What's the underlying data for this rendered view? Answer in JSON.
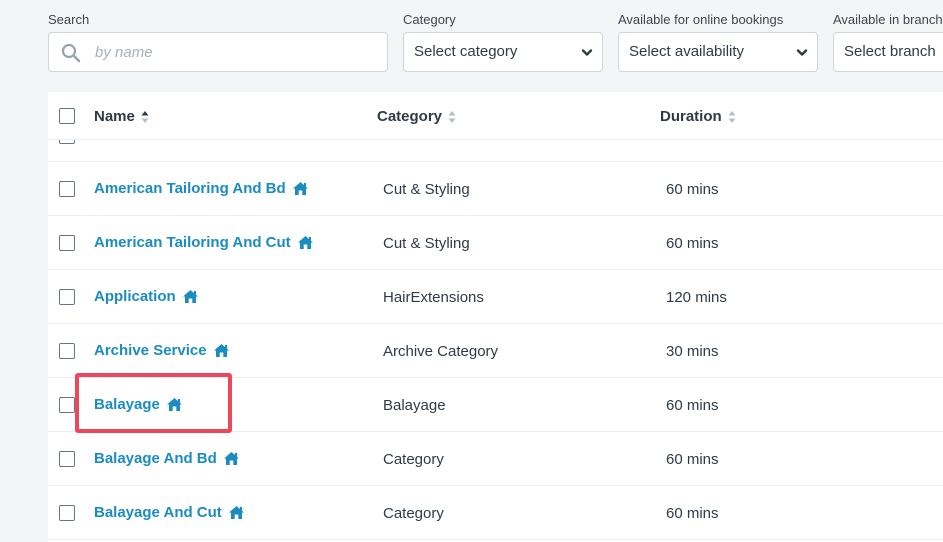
{
  "filters": {
    "search": {
      "label": "Search",
      "placeholder": "by name",
      "value": ""
    },
    "category": {
      "label": "Category",
      "selected": "Select category"
    },
    "online_bookings": {
      "label": "Available for online bookings",
      "selected": "Select availability"
    },
    "branch": {
      "label": "Available in branch",
      "selected": "Select branch"
    }
  },
  "table": {
    "columns": [
      {
        "label": "Name",
        "sort": "ascending"
      },
      {
        "label": "Category",
        "sort": "none"
      },
      {
        "label": "Duration",
        "sort": "none"
      }
    ],
    "rows": [
      {
        "name": "American Tailoring And Bd",
        "category": "Cut & Styling",
        "duration": "60 mins"
      },
      {
        "name": "American Tailoring And Cut",
        "category": "Cut & Styling",
        "duration": "60 mins"
      },
      {
        "name": "Application",
        "category": "HairExtensions",
        "duration": "120 mins"
      },
      {
        "name": "Archive Service",
        "category": "Archive Category",
        "duration": "30 mins"
      },
      {
        "name": "Balayage",
        "category": "Balayage",
        "duration": "60 mins"
      },
      {
        "name": "Balayage And Bd",
        "category": "Category",
        "duration": "60 mins"
      },
      {
        "name": "Balayage And Cut",
        "category": "Category",
        "duration": "60 mins"
      }
    ]
  },
  "icons": {
    "search": "search-icon",
    "dropdown": "chevron-down-icon",
    "home": "home-icon",
    "sort": "sort-icon"
  },
  "colors": {
    "link": "#1b8cc2",
    "highlight": "#f0465a",
    "background": "#f4f5f7"
  }
}
